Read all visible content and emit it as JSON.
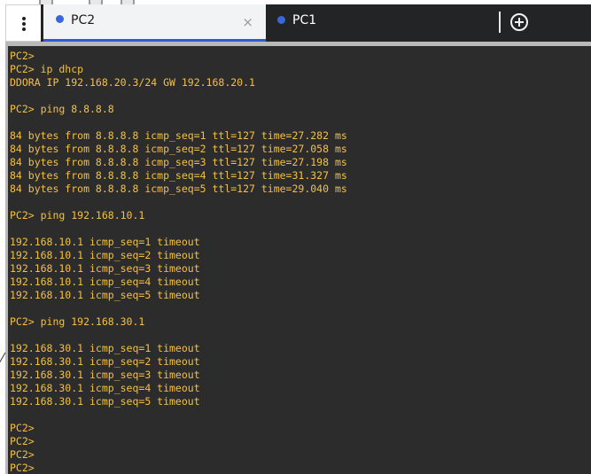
{
  "tabs": [
    {
      "label": "PC2",
      "active": true,
      "dot_color": "#3a66db",
      "closable": true,
      "close_glyph": "×"
    },
    {
      "label": "PC1",
      "active": false,
      "dot_color": "#3a66db",
      "closable": false
    }
  ],
  "icons": {
    "menu": "kebab-menu-icon",
    "close": "close-icon",
    "add": "add-tab-icon"
  },
  "colors": {
    "terminal_bg": "#2c2c2c",
    "terminal_text": "#f4c044",
    "tabbar_bg": "#222426",
    "active_tab_accent": "#2e5bd6"
  },
  "terminal": {
    "lines": [
      "PC2>",
      "PC2> ip dhcp",
      "DDORA IP 192.168.20.3/24 GW 192.168.20.1",
      "",
      "PC2> ping 8.8.8.8",
      "",
      "84 bytes from 8.8.8.8 icmp_seq=1 ttl=127 time=27.282 ms",
      "84 bytes from 8.8.8.8 icmp_seq=2 ttl=127 time=27.058 ms",
      "84 bytes from 8.8.8.8 icmp_seq=3 ttl=127 time=27.198 ms",
      "84 bytes from 8.8.8.8 icmp_seq=4 ttl=127 time=31.327 ms",
      "84 bytes from 8.8.8.8 icmp_seq=5 ttl=127 time=29.040 ms",
      "",
      "PC2> ping 192.168.10.1",
      "",
      "192.168.10.1 icmp_seq=1 timeout",
      "192.168.10.1 icmp_seq=2 timeout",
      "192.168.10.1 icmp_seq=3 timeout",
      "192.168.10.1 icmp_seq=4 timeout",
      "192.168.10.1 icmp_seq=5 timeout",
      "",
      "PC2> ping 192.168.30.1",
      "",
      "192.168.30.1 icmp_seq=1 timeout",
      "192.168.30.1 icmp_seq=2 timeout",
      "192.168.30.1 icmp_seq=3 timeout",
      "192.168.30.1 icmp_seq=4 timeout",
      "192.168.30.1 icmp_seq=5 timeout",
      "",
      "PC2>",
      "PC2>",
      "PC2>",
      "PC2>"
    ]
  }
}
